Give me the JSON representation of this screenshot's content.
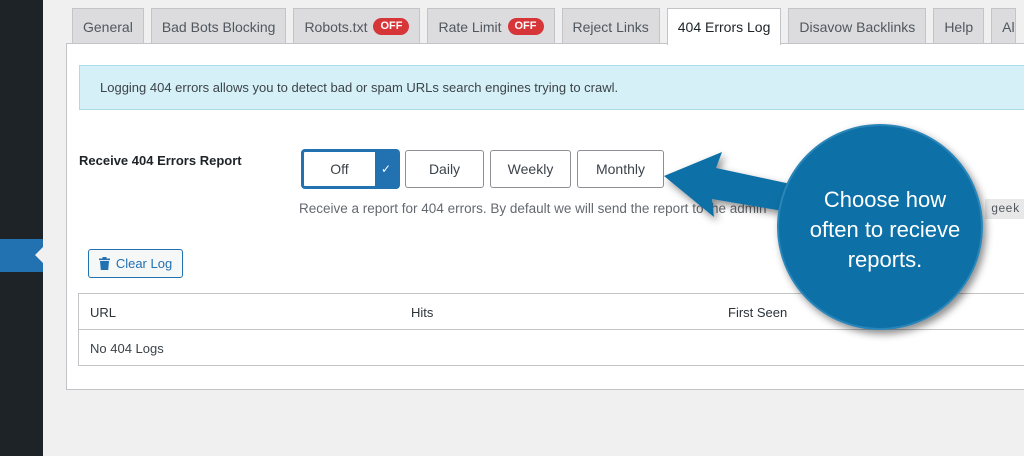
{
  "tabs": [
    {
      "label": "General",
      "badge": ""
    },
    {
      "label": "Bad Bots Blocking",
      "badge": ""
    },
    {
      "label": "Robots.txt",
      "badge": "OFF"
    },
    {
      "label": "Rate Limit",
      "badge": "OFF"
    },
    {
      "label": "Reject Links",
      "badge": ""
    },
    {
      "label": "404 Errors Log",
      "badge": ""
    },
    {
      "label": "Disavow Backlinks",
      "badge": ""
    },
    {
      "label": "Help",
      "badge": ""
    },
    {
      "label": "Al",
      "badge": ""
    }
  ],
  "notice": "Logging 404 errors allows you to detect bad or spam URLs search engines trying to crawl.",
  "report": {
    "label": "Receive 404 Errors Report",
    "options": [
      "Off",
      "Daily",
      "Weekly",
      "Monthly"
    ],
    "selected": "Off",
    "check": "✓",
    "description": "Receive a report for 404 errors. By default we will send the report to the admin",
    "email_fragment": "geek"
  },
  "clear_log_label": "Clear Log",
  "log_table": {
    "columns": [
      "URL",
      "Hits",
      "First Seen"
    ],
    "empty_message": "No 404 Logs"
  },
  "callout": {
    "lines": [
      "Choose how",
      "often to recieve",
      "reports."
    ],
    "color": "#0f6fa6"
  },
  "colors": {
    "accent": "#2271b1",
    "badge_off": "#d63638",
    "notice_bg": "#d5f0f6"
  }
}
